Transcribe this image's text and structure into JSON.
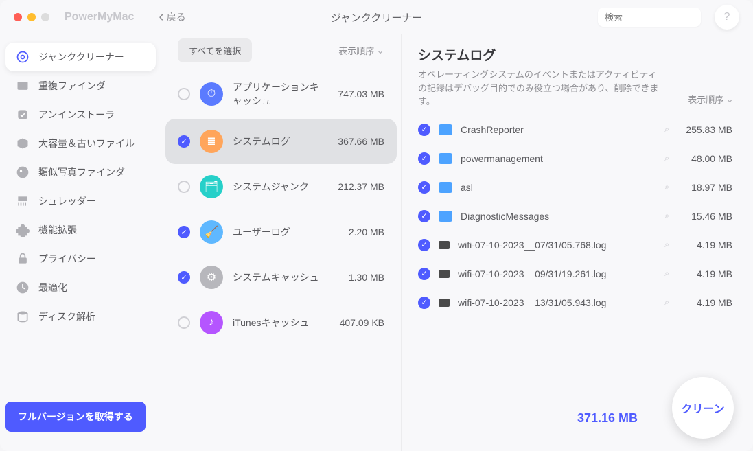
{
  "app": {
    "name": "PowerMyMac"
  },
  "header": {
    "back": "戻る",
    "title": "ジャンククリーナー",
    "search_placeholder": "検索"
  },
  "sidebar": {
    "items": [
      {
        "label": "ジャンククリーナー",
        "icon": "junk"
      },
      {
        "label": "重複ファインダ",
        "icon": "dup"
      },
      {
        "label": "アンインストーラ",
        "icon": "uninst"
      },
      {
        "label": "大容量＆古いファイル",
        "icon": "large"
      },
      {
        "label": "類似写真ファインダ",
        "icon": "photo"
      },
      {
        "label": "シュレッダー",
        "icon": "shred"
      },
      {
        "label": "機能拡張",
        "icon": "ext"
      },
      {
        "label": "プライバシー",
        "icon": "priv"
      },
      {
        "label": "最適化",
        "icon": "opt"
      },
      {
        "label": "ディスク解析",
        "icon": "disk"
      }
    ],
    "promote": "フルバージョンを取得する"
  },
  "mid": {
    "select_all": "すべてを選択",
    "sort": "表示順序",
    "items": [
      {
        "label": "アプリケーションキャッシュ",
        "size": "747.03 MB",
        "checked": false,
        "iconColor": "ic-blue",
        "glyph": "⏱"
      },
      {
        "label": "システムログ",
        "size": "367.66 MB",
        "checked": true,
        "selected": true,
        "iconColor": "ic-orange",
        "glyph": "≣"
      },
      {
        "label": "システムジャンク",
        "size": "212.37 MB",
        "checked": false,
        "iconColor": "ic-teal",
        "glyph": "🗂"
      },
      {
        "label": "ユーザーログ",
        "size": "2.20 MB",
        "checked": true,
        "iconColor": "ic-bluel",
        "glyph": "🧹"
      },
      {
        "label": "システムキャッシュ",
        "size": "1.30 MB",
        "checked": true,
        "iconColor": "ic-grey",
        "glyph": "⚙"
      },
      {
        "label": "iTunesキャッシュ",
        "size": "407.09 KB",
        "checked": false,
        "iconColor": "ic-purple",
        "glyph": "♪"
      }
    ]
  },
  "right": {
    "title": "システムログ",
    "desc": "オペレーティングシステムのイベントまたはアクティビティの記録はデバッグ目的でのみ役立つ場合があり、削除できます。",
    "sort": "表示順序",
    "files": [
      {
        "name": "CrashReporter",
        "type": "folder",
        "size": "255.83 MB"
      },
      {
        "name": "powermanagement",
        "type": "folder",
        "size": "48.00 MB"
      },
      {
        "name": "asl",
        "type": "folder",
        "size": "18.97 MB"
      },
      {
        "name": "DiagnosticMessages",
        "type": "folder",
        "size": "15.46 MB"
      },
      {
        "name": "wifi-07-10-2023__07/31/05.768.log",
        "type": "log",
        "size": "4.19 MB"
      },
      {
        "name": "wifi-07-10-2023__09/31/19.261.log",
        "type": "log",
        "size": "4.19 MB"
      },
      {
        "name": "wifi-07-10-2023__13/31/05.943.log",
        "type": "log",
        "size": "4.19 MB"
      }
    ]
  },
  "footer": {
    "total": "371.16 MB",
    "clean": "クリーン"
  }
}
